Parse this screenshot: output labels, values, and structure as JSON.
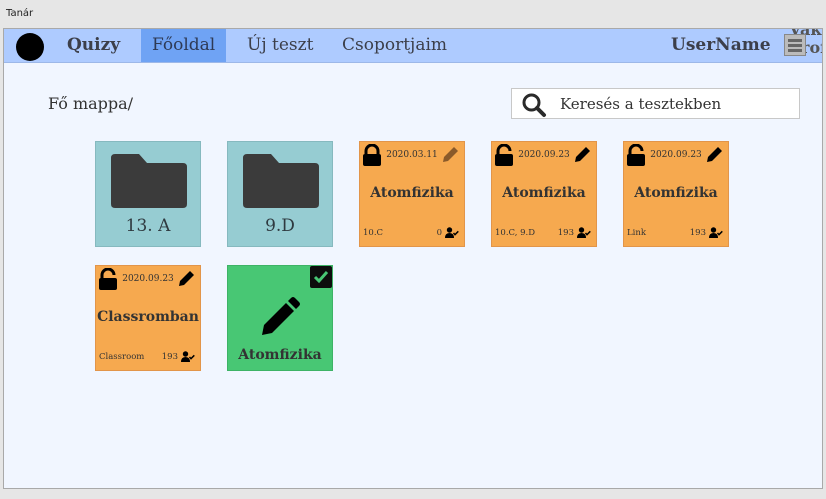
{
  "window": {
    "title": "Tanár"
  },
  "nav": {
    "brand": "Quizy",
    "links": [
      "Főoldal",
      "Új teszt",
      "Csoportjaim"
    ],
    "username": "UserName",
    "overflow_text": "Vak Prof"
  },
  "breadcrumb": "Fő mappa/",
  "search": {
    "placeholder": "Keresés a tesztekben"
  },
  "folders": [
    {
      "name": "13. A"
    },
    {
      "name": "9.D"
    }
  ],
  "tests": [
    {
      "date": "2020.03.11",
      "title": "Atomfizika",
      "group": "10.C",
      "count": "0",
      "locked": true,
      "edit_color": "#8a5a2a"
    },
    {
      "date": "2020.09.23",
      "title": "Atomfizika",
      "group": "10.C, 9.D",
      "count": "193",
      "locked": false,
      "edit_color": "#000000"
    },
    {
      "date": "2020.09.23",
      "title": "Atomfizika",
      "group": "Link",
      "count": "193",
      "locked": false,
      "edit_color": "#000000"
    },
    {
      "date": "2020.09.23",
      "title": "Classromban",
      "group": "Classroom",
      "count": "193",
      "locked": false,
      "edit_color": "#000000"
    }
  ],
  "new_test": {
    "title": "Atomfizika"
  },
  "colors": {
    "nav_bg": "#aecbff",
    "nav_active": "#6fa3f4",
    "folder": "#96ccd2",
    "test": "#f6a94f",
    "new_test": "#48c774"
  }
}
